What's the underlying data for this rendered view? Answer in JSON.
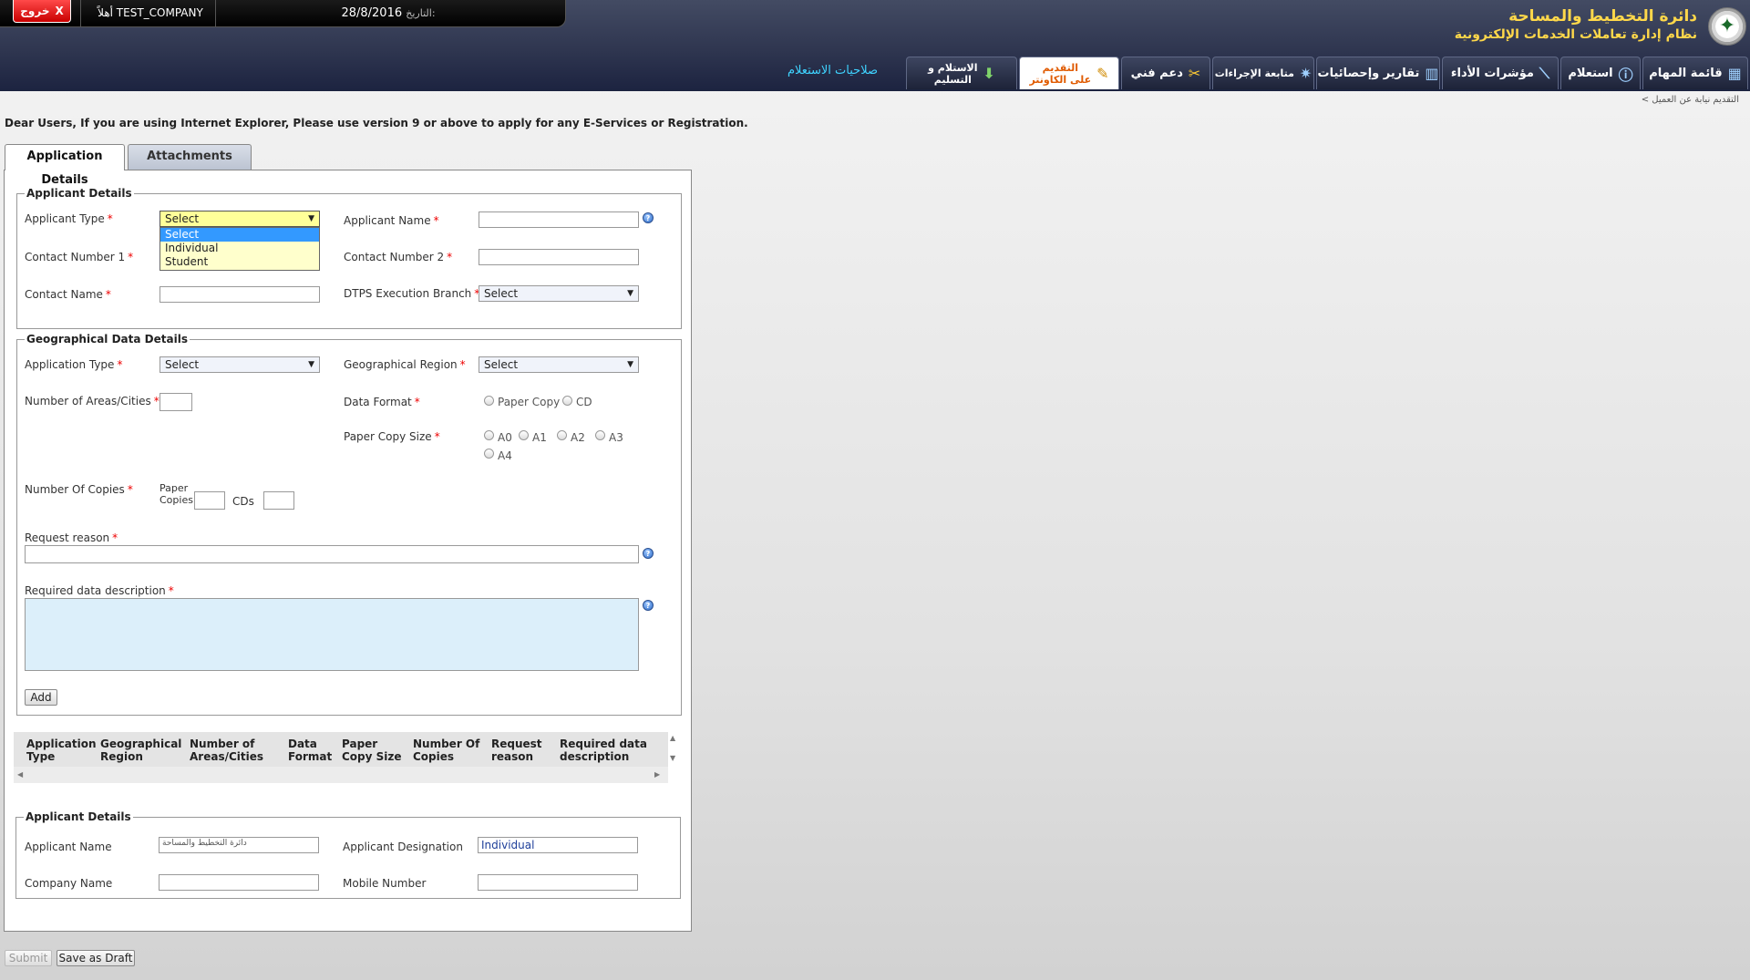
{
  "header": {
    "logout_label": "خروج",
    "logout_x": "X",
    "welcome": "أهلاً TEST_COMPANY",
    "date_label": "التاريخ:",
    "date_value": "28/8/2016",
    "title_line1": "دائرة التخطيط والمساحة",
    "title_line2": "نظام إدارة تعاملات الخدمات الإلكترونية"
  },
  "nav": {
    "tasks": "قائمة المهام",
    "inquiry": "استعلام",
    "kpi": "مؤشرات الأداء",
    "reports": "تقارير وإحصائيات",
    "follow_procedures": "متابعة الإجراءات",
    "tech_support": "دعم فني",
    "counter_line1": "التقديم",
    "counter_line2": "على الكاونتر",
    "receive_line1": "الاستلام و",
    "receive_line2": "التسليم",
    "permissions": "صلاحيات الاستعلام"
  },
  "breadcrumb": "التقديم نيابة عن العميل >",
  "notice": "Dear Users, If you are using Internet Explorer, Please use version 9 or above to apply for any E-Services or Registration.",
  "tabs": {
    "application_details": "Application Details",
    "attachments": "Attachments"
  },
  "applicant_details": {
    "legend": "Applicant Details",
    "applicant_type_label": "Applicant Type",
    "applicant_type_value": "Select",
    "applicant_type_options": [
      "Select",
      "Individual",
      "Student"
    ],
    "applicant_name_label": "Applicant Name",
    "contact1_label": "Contact Number 1",
    "contact2_label": "Contact Number 2",
    "contact_name_label": "Contact Name",
    "branch_label": "DTPS Execution Branch",
    "branch_value": "Select"
  },
  "geo": {
    "legend": "Geographical Data Details",
    "app_type_label": "Application Type",
    "app_type_value": "Select",
    "region_label": "Geographical Region",
    "region_value": "Select",
    "num_areas_label": "Number of Areas/Cities",
    "data_format_label": "Data Format",
    "format_paper": "Paper Copy",
    "format_cd": "CD",
    "paper_size_label": "Paper Copy Size",
    "sizes": [
      "A0",
      "A1",
      "A2",
      "A3",
      "A4"
    ],
    "num_copies_label": "Number Of Copies",
    "paper_copies_label_1": "Paper",
    "paper_copies_label_2": "Copies",
    "cds_label": "CDs",
    "request_reason_label": "Request reason",
    "required_desc_label": "Required data description",
    "add_button": "Add"
  },
  "grid_columns": [
    [
      "Application",
      "Type"
    ],
    [
      "Geographical",
      "Region"
    ],
    [
      "Number of",
      "Areas/Cities"
    ],
    [
      "Data",
      "Format"
    ],
    [
      "Paper",
      "Copy Size"
    ],
    [
      "Number Of",
      "Copies"
    ],
    [
      "Request",
      "reason"
    ],
    [
      "Required data",
      "description"
    ]
  ],
  "applicant_details_2": {
    "legend": "Applicant Details",
    "name_label": "Applicant Name",
    "name_value": "دائرة التخطيط والمساحة",
    "designation_label": "Applicant Designation",
    "designation_value": "Individual",
    "company_label": "Company Name",
    "mobile_label": "Mobile Number"
  },
  "actions": {
    "submit": "Submit",
    "save_draft": "Save as Draft"
  },
  "colors": {
    "header_dark": "#1c2340",
    "title_yellow": "#ffd84a",
    "logout_red": "#e00000",
    "link_cyan": "#3fd3ff",
    "active_orange": "#e05a00",
    "select_highlight": "#3399ff",
    "focus_yellow": "#ffff99"
  }
}
